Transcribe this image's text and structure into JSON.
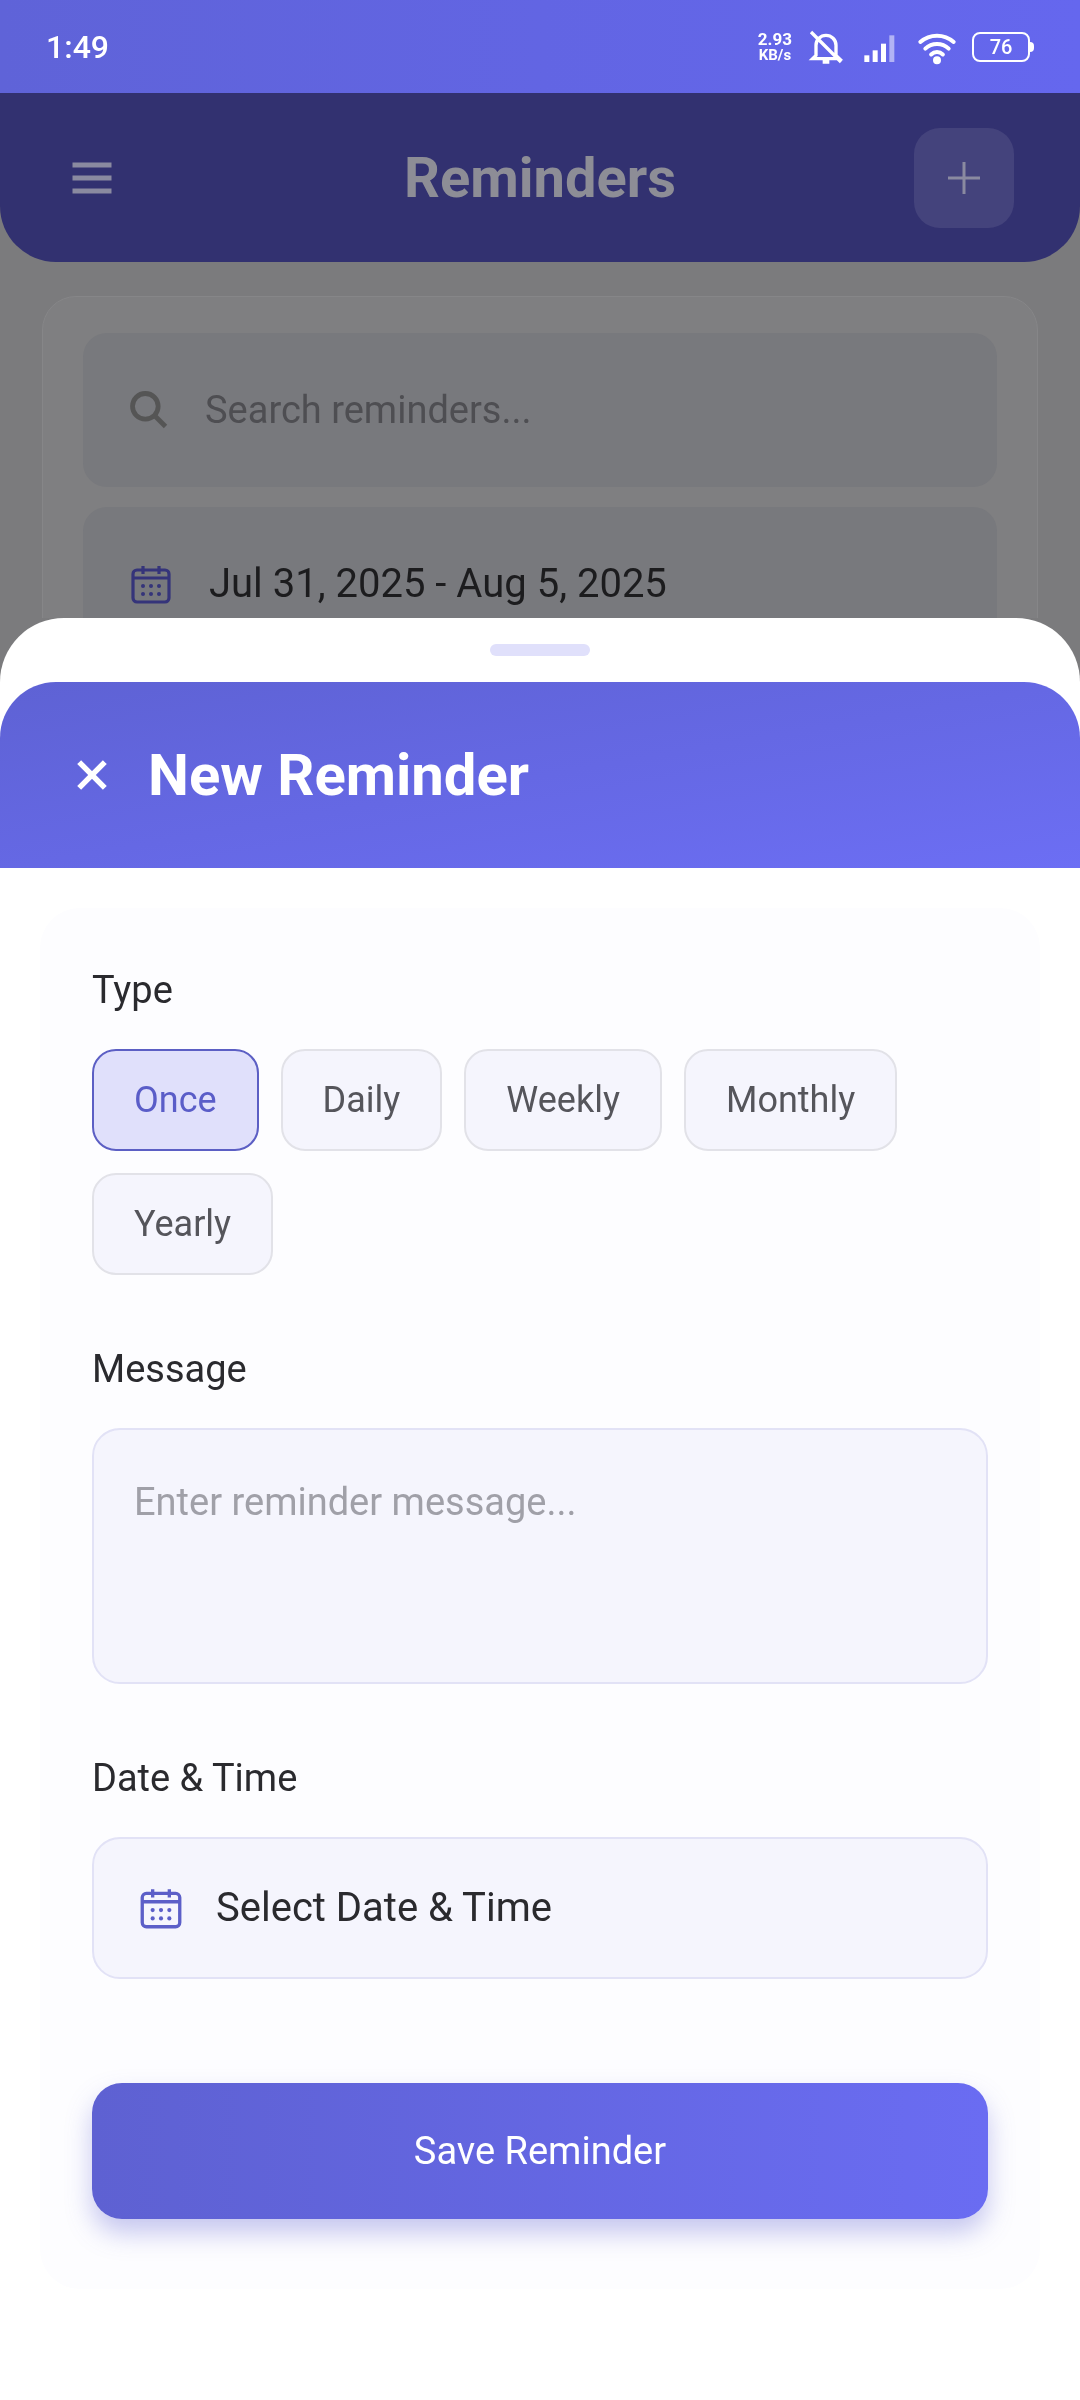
{
  "status_bar": {
    "time": "1:49",
    "net_speed": "2.93",
    "net_unit": "KB/s",
    "battery": "76"
  },
  "app_bar": {
    "title": "Reminders"
  },
  "search": {
    "placeholder": "Search reminders..."
  },
  "date_range": {
    "value": "Jul 31, 2025 - Aug 5, 2025"
  },
  "sheet": {
    "title": "New Reminder",
    "type_label": "Type",
    "types": [
      {
        "label": "Once",
        "selected": true
      },
      {
        "label": "Daily",
        "selected": false
      },
      {
        "label": "Weekly",
        "selected": false
      },
      {
        "label": "Monthly",
        "selected": false
      },
      {
        "label": "Yearly",
        "selected": false
      }
    ],
    "message_label": "Message",
    "message": {
      "placeholder": "Enter reminder message..."
    },
    "datetime_label": "Date & Time",
    "datetime_button": "Select Date & Time",
    "save_button": "Save Reminder"
  }
}
